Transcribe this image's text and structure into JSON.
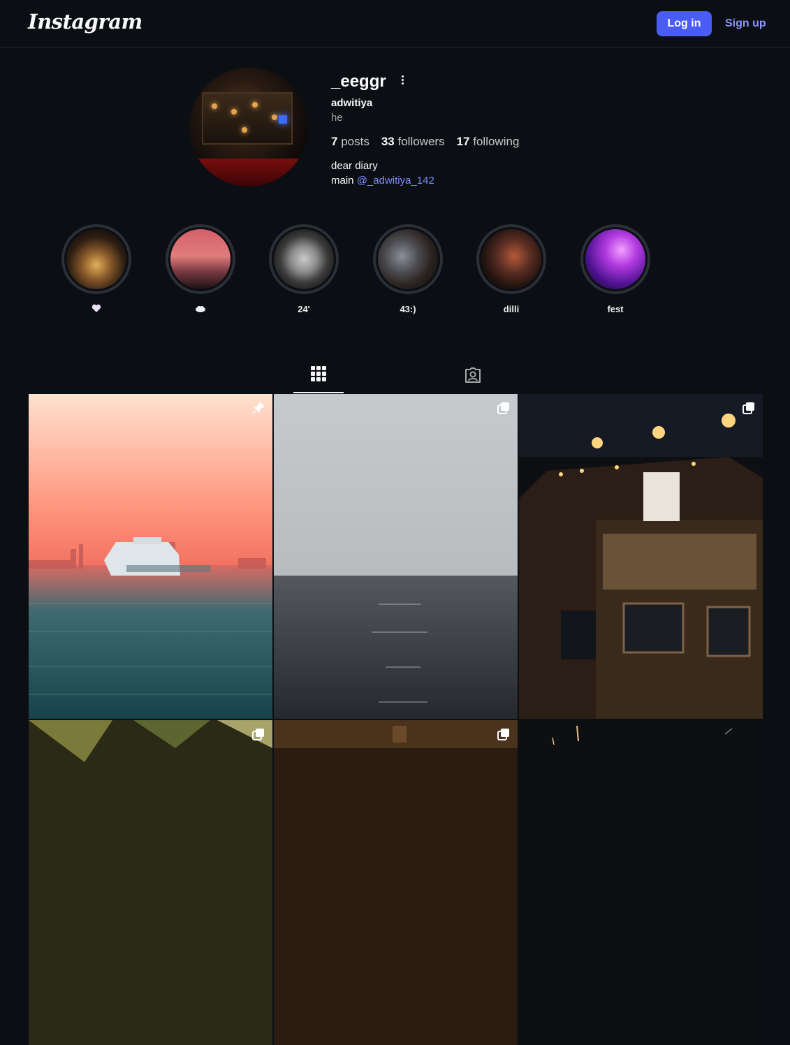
{
  "header": {
    "logo": "Instagram",
    "login_label": "Log in",
    "signup_label": "Sign up"
  },
  "profile": {
    "username": "_eeggr",
    "full_name": "adwitiya",
    "pronouns": "he",
    "posts_count": "7",
    "posts_label": "posts",
    "followers_count": "33",
    "followers_label": "followers",
    "following_count": "17",
    "following_label": "following",
    "bio_line1": "dear diary",
    "bio_line2_prefix": "main",
    "bio_mention": "@_adwitiya_142"
  },
  "highlights": [
    {
      "label": "🤍",
      "icon": "heart-icon"
    },
    {
      "label": "☁",
      "icon": "cloud-icon"
    },
    {
      "label": "24'"
    },
    {
      "label": "43:)"
    },
    {
      "label": "dilli"
    },
    {
      "label": "fest"
    }
  ],
  "tabs": {
    "active": "posts-grid",
    "items": [
      "posts-grid-icon",
      "tagged-icon"
    ]
  },
  "posts": [
    {
      "badge": "pin-icon"
    },
    {
      "badge": "carousel-icon"
    },
    {
      "badge": "carousel-icon"
    },
    {
      "badge": "carousel-icon"
    },
    {
      "badge": "carousel-icon"
    },
    {
      "badge": ""
    }
  ],
  "colors": {
    "background": "#0b0e13",
    "accent": "#4a5cf6",
    "link": "#7e8dff"
  }
}
